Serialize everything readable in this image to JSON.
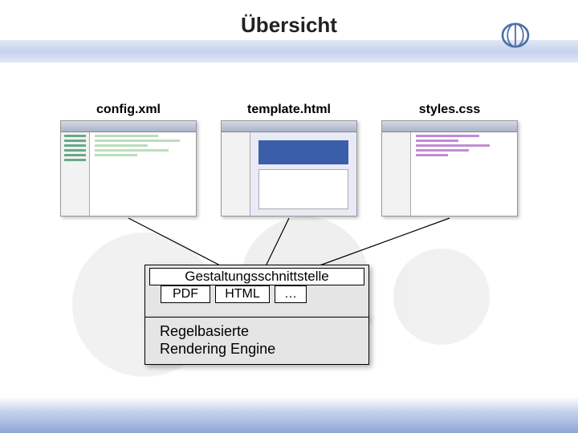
{
  "title": "Übersicht",
  "files": {
    "config": "config.xml",
    "template": "template.html",
    "styles": "styles.css"
  },
  "interface_label": "Gestaltungsschnittstelle",
  "plugins": {
    "pdf": "PDF",
    "html": "HTML",
    "more": "…"
  },
  "engine_label": "Regelbasierte\nRendering Engine",
  "logo_name": "institution-logo"
}
